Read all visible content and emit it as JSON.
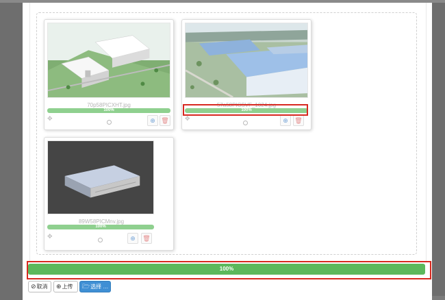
{
  "files": [
    {
      "name": "70p58PICXHT.jpg",
      "progress": 1.0,
      "progress_text": "100%",
      "image": "factory-rendering-green-campus"
    },
    {
      "name": "57a58PICSVF_1024.jpg",
      "progress": 1.0,
      "progress_text": "100%",
      "image": "aerial-factory-blue-roofs"
    },
    {
      "name": "89W58PICMnv.jpg",
      "progress": 1.0,
      "progress_text": "100%",
      "image": "3d-warehouse-model-dark-background"
    }
  ],
  "thumb_icons": {
    "drag": "drag-handle-icon",
    "zoom": "zoom-icon",
    "upload": "upload-circle-icon",
    "delete": "trash-icon"
  },
  "overall_progress": {
    "value": 1.0,
    "text": "100%"
  },
  "actions": {
    "cancel": {
      "icon": "ban-icon",
      "label": "取消"
    },
    "upload": {
      "icon": "upload-circle-icon",
      "label": "上传"
    },
    "browse": {
      "icon": "folder-open-icon",
      "label": "选择 …"
    }
  },
  "colors": {
    "progress_green": "#5cb85c",
    "primary_blue": "#3f8fd4",
    "highlight_red": "#d7281f"
  }
}
